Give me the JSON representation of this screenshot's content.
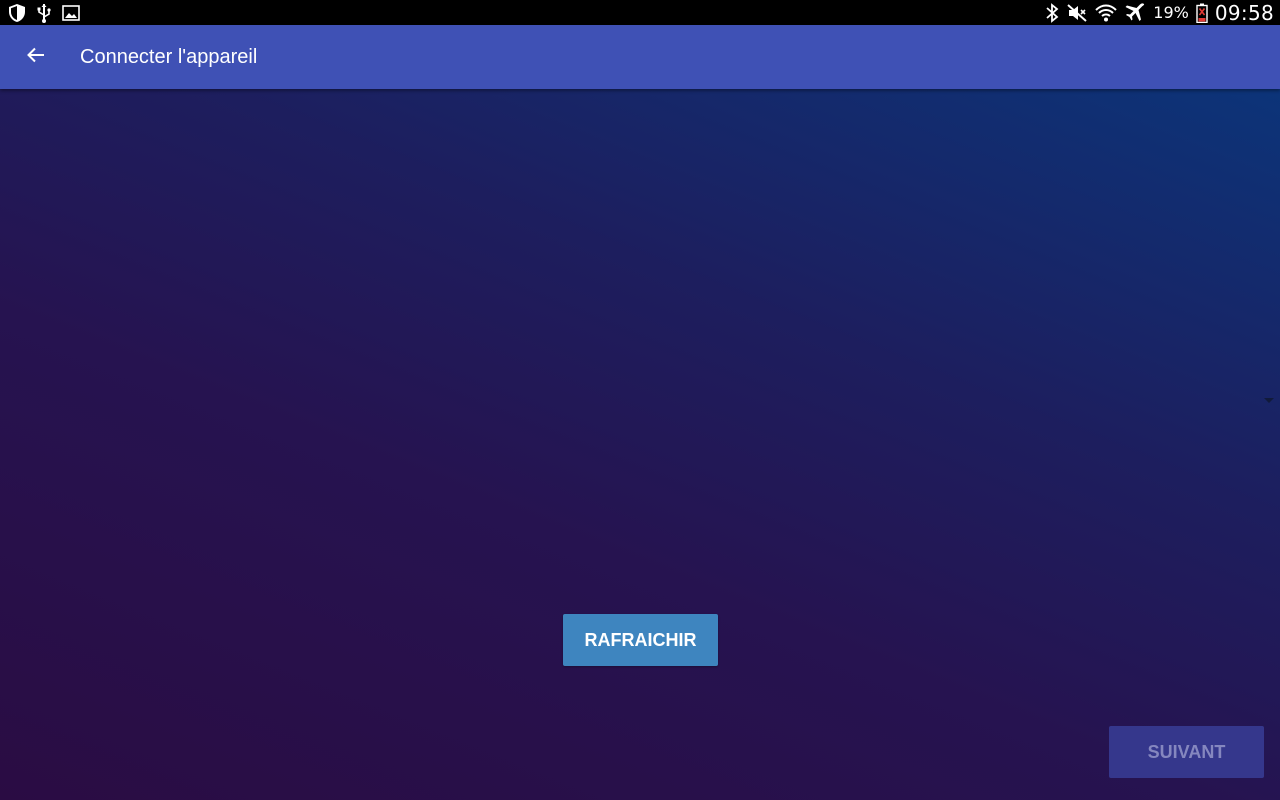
{
  "status_bar": {
    "left_icons": [
      "shield-icon",
      "usb-icon",
      "image-icon"
    ],
    "right_icons": [
      "bluetooth-icon",
      "mute-icon",
      "wifi-icon",
      "airplane-icon",
      "battery-icon"
    ],
    "battery_percent": "19%",
    "time": "09:58"
  },
  "app_bar": {
    "title": "Connecter l'appareil",
    "back_icon": "arrow-left-icon",
    "color": "#3f51b5"
  },
  "main": {
    "refresh_label": "RAFRAICHIR",
    "next_label": "SUIVANT",
    "next_enabled": false,
    "dropdown_icon": "caret-down-icon"
  },
  "colors": {
    "accent_button": "#3e85bf",
    "disabled_button": "#35378c"
  }
}
